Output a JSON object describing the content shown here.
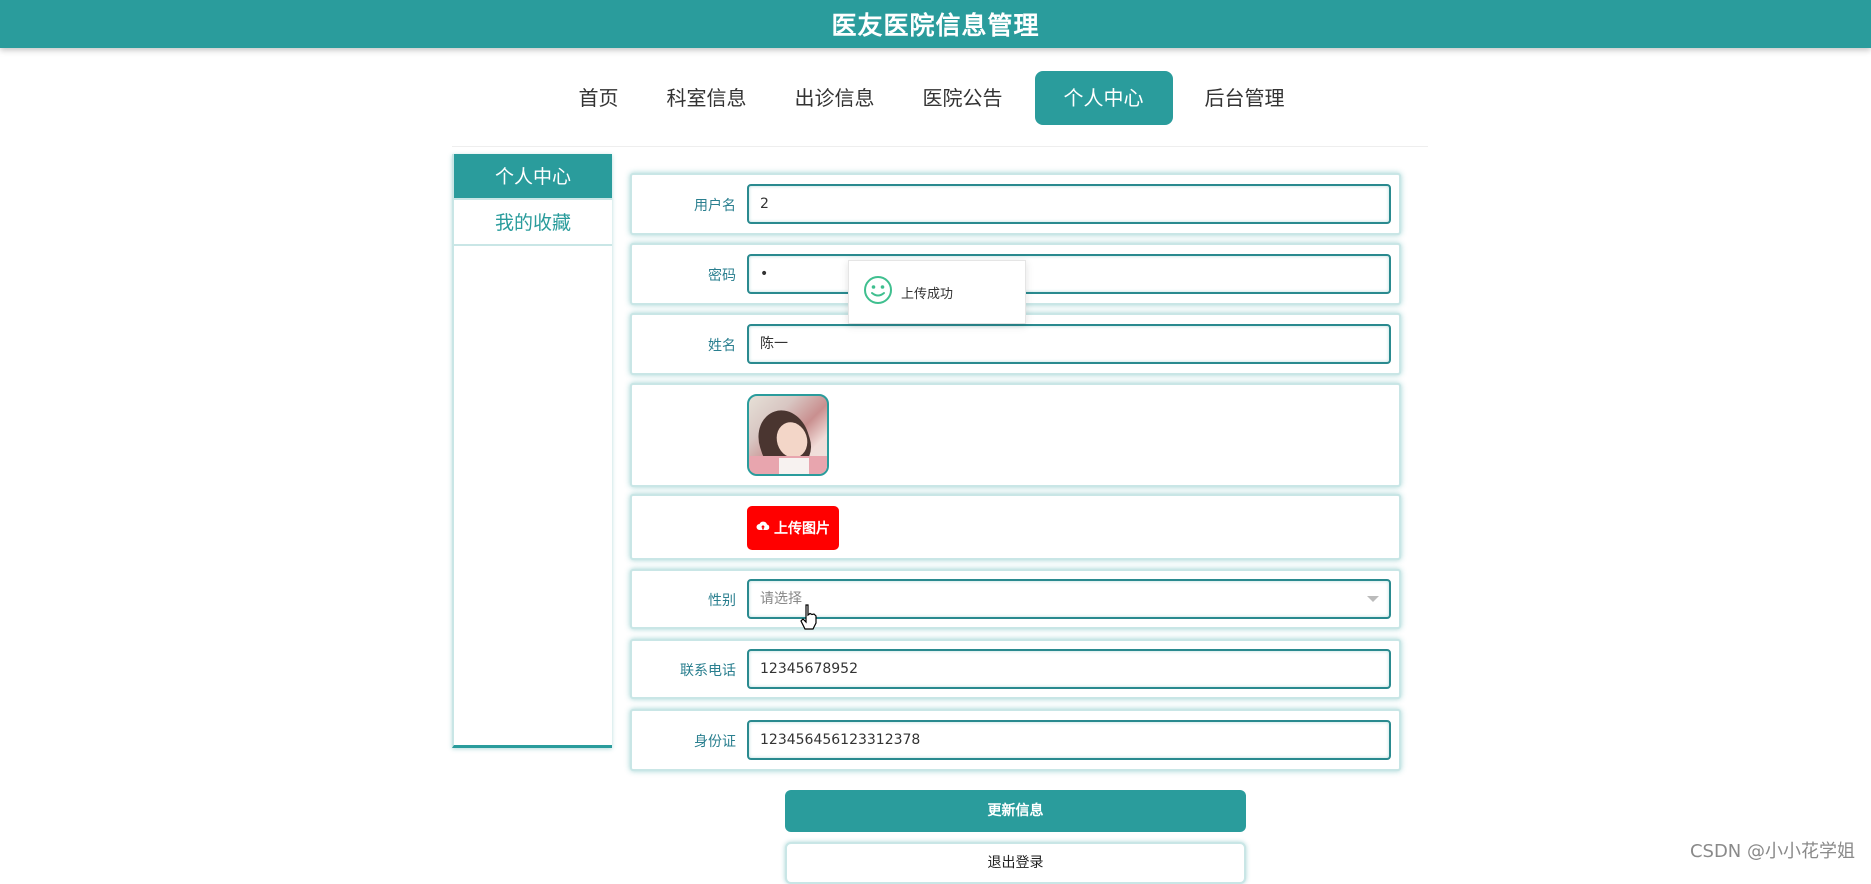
{
  "app": {
    "title": "医友医院信息管理"
  },
  "nav": {
    "items": [
      {
        "label": "首页"
      },
      {
        "label": "科室信息"
      },
      {
        "label": "出诊信息"
      },
      {
        "label": "医院公告"
      },
      {
        "label": "个人中心",
        "active": true
      },
      {
        "label": "后台管理"
      }
    ]
  },
  "sidebar": {
    "items": [
      {
        "label": "个人中心",
        "active": true
      },
      {
        "label": "我的收藏"
      }
    ]
  },
  "form": {
    "username": {
      "label": "用户名",
      "value": "2"
    },
    "password": {
      "label": "密码",
      "value": "•"
    },
    "name": {
      "label": "姓名",
      "value": "陈一"
    },
    "avatar": {
      "icon": "avatar-photo"
    },
    "upload": {
      "label": "上传图片",
      "icon": "cloud-upload-icon"
    },
    "gender": {
      "label": "性别",
      "placeholder": "请选择"
    },
    "phone": {
      "label": "联系电话",
      "value": "12345678952"
    },
    "idcard": {
      "label": "身份证",
      "value": "123456456123312378"
    }
  },
  "toast": {
    "text": "上传成功",
    "icon": "smile-icon"
  },
  "actions": {
    "update_label": "更新信息",
    "logout_label": "退出登录"
  },
  "watermark": "CSDN @小小花学姐",
  "colors": {
    "primary": "#2a9c9c",
    "danger": "#ff0000"
  }
}
